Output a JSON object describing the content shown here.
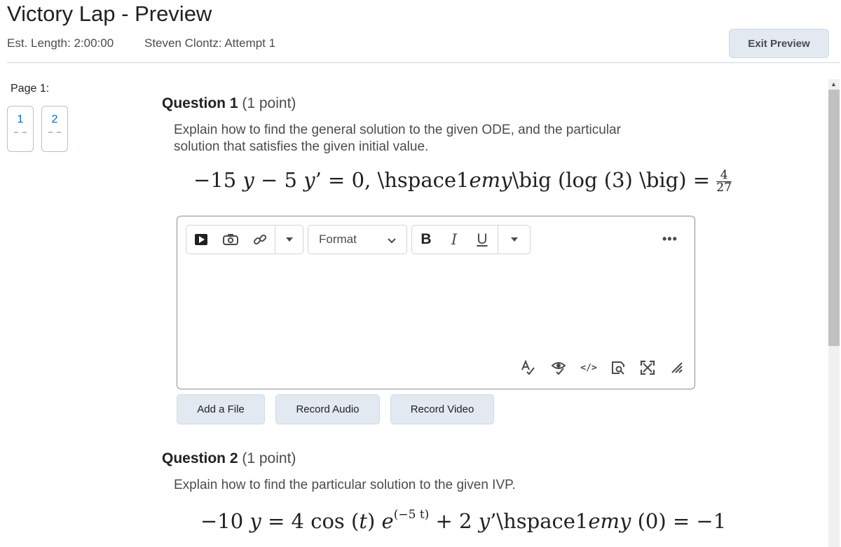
{
  "header": {
    "title": "Victory Lap - Preview",
    "est_length": "Est. Length: 2:00:00",
    "attempt": "Steven Clontz: Attempt 1",
    "exit_label": "Exit Preview"
  },
  "sidebar": {
    "page_label": "Page 1:",
    "pages": [
      {
        "num": "1",
        "color": "#006fbf"
      },
      {
        "num": "2",
        "color": "#006fbf"
      }
    ]
  },
  "questions": [
    {
      "number": "Question 1",
      "points": "(1 point)",
      "text": "Explain how to find the general solution to the given ODE, and the particular solution that satisfies the given initial value.",
      "math": {
        "part1": "−15",
        "var1": "y",
        "part2": "− 5",
        "var2": "y",
        "part3": "’ = 0, \\hspace1",
        "em": "emy",
        "part4": "\\big (log (3) \\big) =",
        "frac_num": "4",
        "frac_den": "27"
      }
    },
    {
      "number": "Question 2",
      "points": "(1 point)",
      "text": "Explain how to find the particular solution to the given IVP.",
      "math": {
        "part1": "−10",
        "var1": "y",
        "part2": "= 4 cos (",
        "var_t": "t",
        "part3": ")",
        "var_e": "e",
        "exp": "(−5 t)",
        "part4": "+ 2",
        "var2": "y",
        "part5": "’\\hspace1",
        "em": "emy",
        "part6": "(0) = −1"
      }
    }
  ],
  "editor": {
    "format_label": "Format",
    "bold": "B",
    "italic": "I",
    "underline": "U",
    "more": "•••",
    "toolbar_icons": [
      "video-icon",
      "camera-icon",
      "link-icon",
      "dropdown-icon"
    ],
    "bottom_icons": [
      "spellcheck-icon",
      "accessibility-checker-icon",
      "source-code-icon",
      "preview-icon",
      "fullscreen-icon",
      "resize-handle-icon"
    ]
  },
  "actions": {
    "add_file": "Add a File",
    "record_audio": "Record Audio",
    "record_video": "Record Video"
  }
}
